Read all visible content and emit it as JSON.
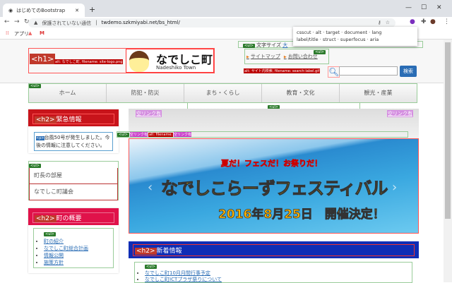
{
  "browser": {
    "tab_title": "はじめてのBootstrap",
    "security": "保護されていない通信",
    "url": "twdemo.szkmiyabi.net/bs_html/",
    "bookmarks": [
      "アプリ"
    ]
  },
  "extension": {
    "items": [
      "csscut",
      "alt",
      "target",
      "document",
      "lang",
      "label/title",
      "struct",
      "superfocus",
      "aria"
    ]
  },
  "header": {
    "h1_tag": "<h1>",
    "logo_alt": "alt: なでしこ町, filename: site-logo.png",
    "town_name": "なでしこ町",
    "town_en": "Nadeshiko Town",
    "text_size_label": "文字サイズ",
    "text_size_value": "大",
    "links": [
      "サイトマップ",
      "お問い合わせ"
    ],
    "search_alt": "alt: サイト内検索, filename: search-label.gif",
    "search_button": "検索",
    "ul_tag": "<ul>"
  },
  "nav": {
    "items": [
      "ホーム",
      "防犯・防災",
      "まち・くらし",
      "教育・文化",
      "観光・産業"
    ]
  },
  "sidebar": {
    "emergency": {
      "tag": "<h2>",
      "title": "緊急情報",
      "p_tag": "<p>",
      "text": "台風50号が発生しました。今後の情報に注意してください。"
    },
    "menu": [
      "町長の部屋",
      "なでしこ町議会"
    ],
    "overview": {
      "tag": "<h2>",
      "title": "町の概要",
      "items": [
        "町の紹介",
        "なでしこ町総合計画",
        "情報公開",
        "施策方針"
      ]
    }
  },
  "carousel": {
    "empty_link": "空リンク有",
    "indicator_alt": "alt: filename:",
    "headline": "夏だ！フェスだ！お祭りだ！",
    "title": "なでしこらーずフェスティバル",
    "date": "2016年8月25日　開催決定！"
  },
  "news": {
    "tag": "<h2>",
    "title": "新着情報",
    "items": [
      "なでしこ町10月月間行事予定",
      "なでしこ町ICTプラザ祭りについて"
    ]
  }
}
